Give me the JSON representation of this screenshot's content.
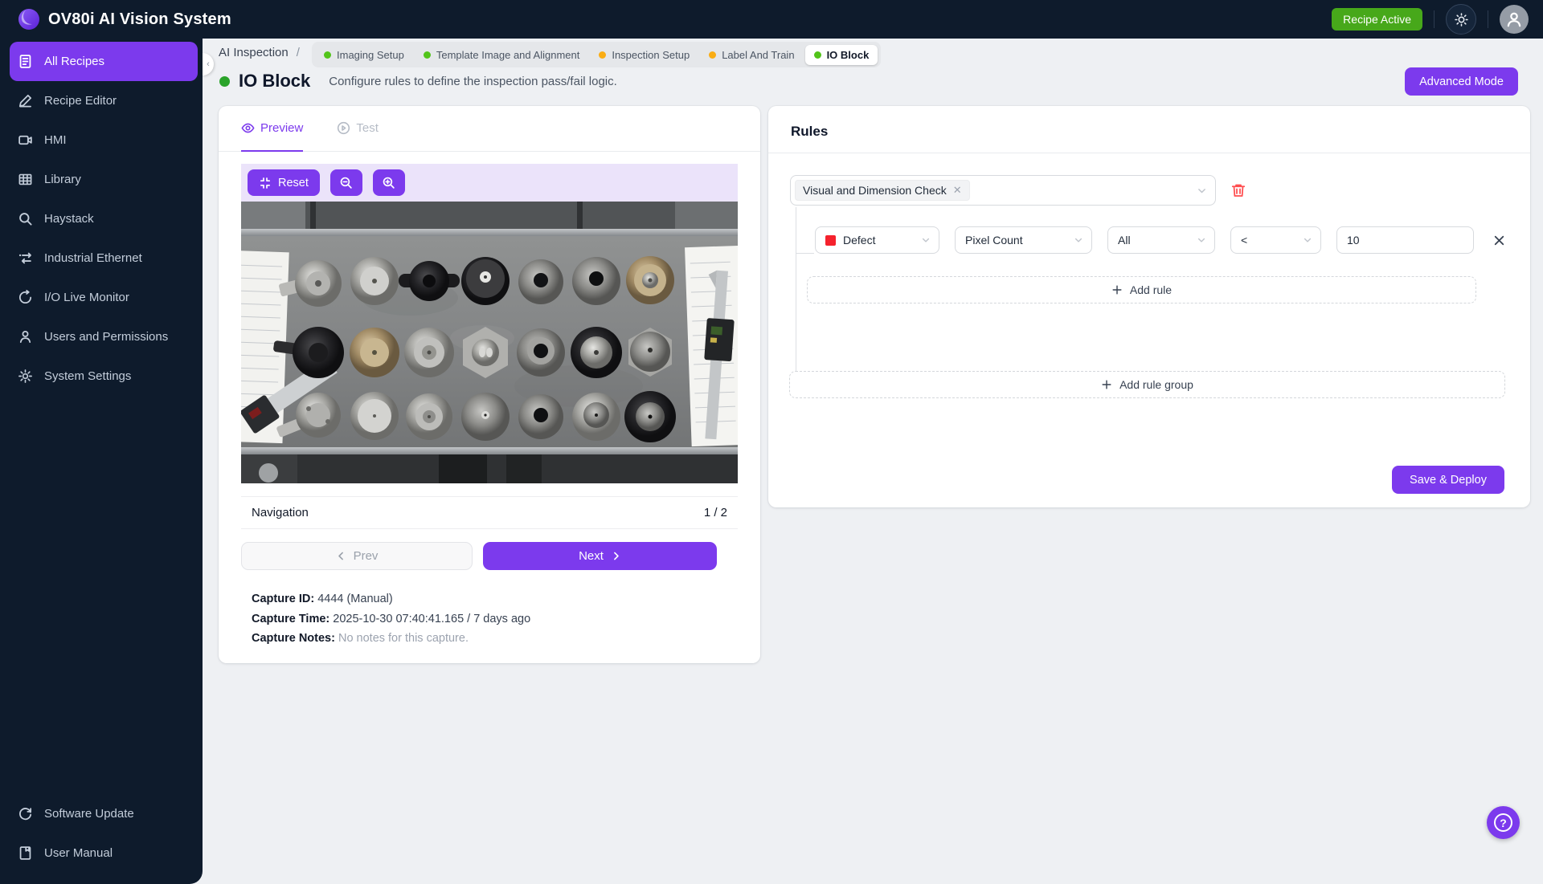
{
  "header": {
    "title": "OV80i AI Vision System",
    "badge": "Recipe Active"
  },
  "sidebar": {
    "items": [
      {
        "label": "All Recipes",
        "active": true
      },
      {
        "label": "Recipe Editor",
        "active": false
      },
      {
        "label": "HMI",
        "active": false
      },
      {
        "label": "Library",
        "active": false
      },
      {
        "label": "Haystack",
        "active": false
      },
      {
        "label": "Industrial Ethernet",
        "active": false
      },
      {
        "label": "I/O Live Monitor",
        "active": false
      },
      {
        "label": "Users and Permissions",
        "active": false
      },
      {
        "label": "System Settings",
        "active": false
      }
    ],
    "footer": [
      {
        "label": "Software Update"
      },
      {
        "label": "User Manual"
      }
    ]
  },
  "breadcrumb": {
    "root": "AI Inspection",
    "sep": "/",
    "steps": [
      {
        "label": "Imaging Setup",
        "status": "green",
        "active": false
      },
      {
        "label": "Template Image and Alignment",
        "status": "green",
        "active": false
      },
      {
        "label": "Inspection Setup",
        "status": "orange",
        "active": false
      },
      {
        "label": "Label And Train",
        "status": "orange",
        "active": false
      },
      {
        "label": "IO Block",
        "status": "green",
        "active": true
      }
    ]
  },
  "page": {
    "title": "IO Block",
    "subtitle": "Configure rules to define the inspection pass/fail logic.",
    "advanced_button": "Advanced Mode"
  },
  "preview": {
    "tabs": [
      {
        "label": "Preview",
        "active": true
      },
      {
        "label": "Test",
        "active": false
      }
    ],
    "toolbar": {
      "reset": "Reset"
    },
    "nav": {
      "title": "Navigation",
      "counter": "1 / 2",
      "prev": "Prev",
      "next": "Next"
    },
    "capture": {
      "id_label": "Capture ID:",
      "id_value": "4444 (Manual)",
      "time_label": "Capture Time:",
      "time_value": "2025-10-30 07:40:41.165 / 7 days ago",
      "notes_label": "Capture Notes:",
      "notes_value": "No notes for this capture."
    }
  },
  "rules": {
    "title": "Rules",
    "group_tag": "Visual and Dimension Check",
    "rule": {
      "class": "Defect",
      "metric": "Pixel Count",
      "scope": "All",
      "operator": "<",
      "value": "10"
    },
    "add_rule": "Add rule",
    "add_rule_group": "Add rule group",
    "save_button": "Save & Deploy"
  },
  "colors": {
    "accent_purple": "#7c3aed",
    "badge_green": "#47a81a",
    "status_green": "#52c41a",
    "status_orange": "#faad14",
    "danger_red": "#ff4d4f",
    "defect_swatch": "#f5222d",
    "sidebar_bg": "#0e1b2c"
  }
}
